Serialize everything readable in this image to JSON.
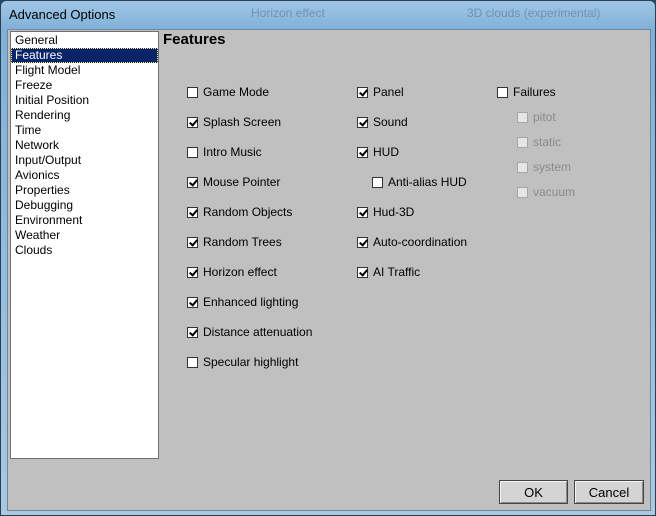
{
  "window": {
    "title": "Advanced Options",
    "ghost_left": "Horizon effect",
    "ghost_right": "3D clouds (experimental)"
  },
  "nav": {
    "items": [
      "General",
      "Features",
      "Flight Model",
      "Freeze",
      "Initial Position",
      "Rendering",
      "Time",
      "Network",
      "Input/Output",
      "Avionics",
      "Properties",
      "Debugging",
      "Environment",
      "Weather",
      "Clouds"
    ],
    "selected": "Features"
  },
  "page": {
    "heading": "Features",
    "col1": [
      {
        "label": "Game Mode",
        "checked": false
      },
      {
        "label": "Splash Screen",
        "checked": true
      },
      {
        "label": "Intro Music",
        "checked": false
      },
      {
        "label": "Mouse Pointer",
        "checked": true
      },
      {
        "label": "Random Objects",
        "checked": true
      },
      {
        "label": "Random Trees",
        "checked": true
      },
      {
        "label": "Horizon effect",
        "checked": true
      },
      {
        "label": "Enhanced lighting",
        "checked": true
      },
      {
        "label": "Distance attenuation",
        "checked": true
      },
      {
        "label": "Specular highlight",
        "checked": false
      }
    ],
    "col2": [
      {
        "label": "Panel",
        "checked": true
      },
      {
        "label": "Sound",
        "checked": true
      },
      {
        "label": "HUD",
        "checked": true
      },
      {
        "label": "Anti-alias HUD",
        "checked": false
      },
      {
        "label": "Hud-3D",
        "checked": true
      },
      {
        "label": "Auto-coordination",
        "checked": true
      },
      {
        "label": "AI Traffic",
        "checked": true
      }
    ],
    "col3": [
      {
        "label": "Failures",
        "checked": false,
        "disabled": false
      },
      {
        "label": "pitot",
        "checked": false,
        "disabled": true
      },
      {
        "label": "static",
        "checked": false,
        "disabled": true
      },
      {
        "label": "system",
        "checked": false,
        "disabled": true
      },
      {
        "label": "vacuum",
        "checked": false,
        "disabled": true
      }
    ]
  },
  "buttons": {
    "ok": "OK",
    "cancel": "Cancel"
  }
}
